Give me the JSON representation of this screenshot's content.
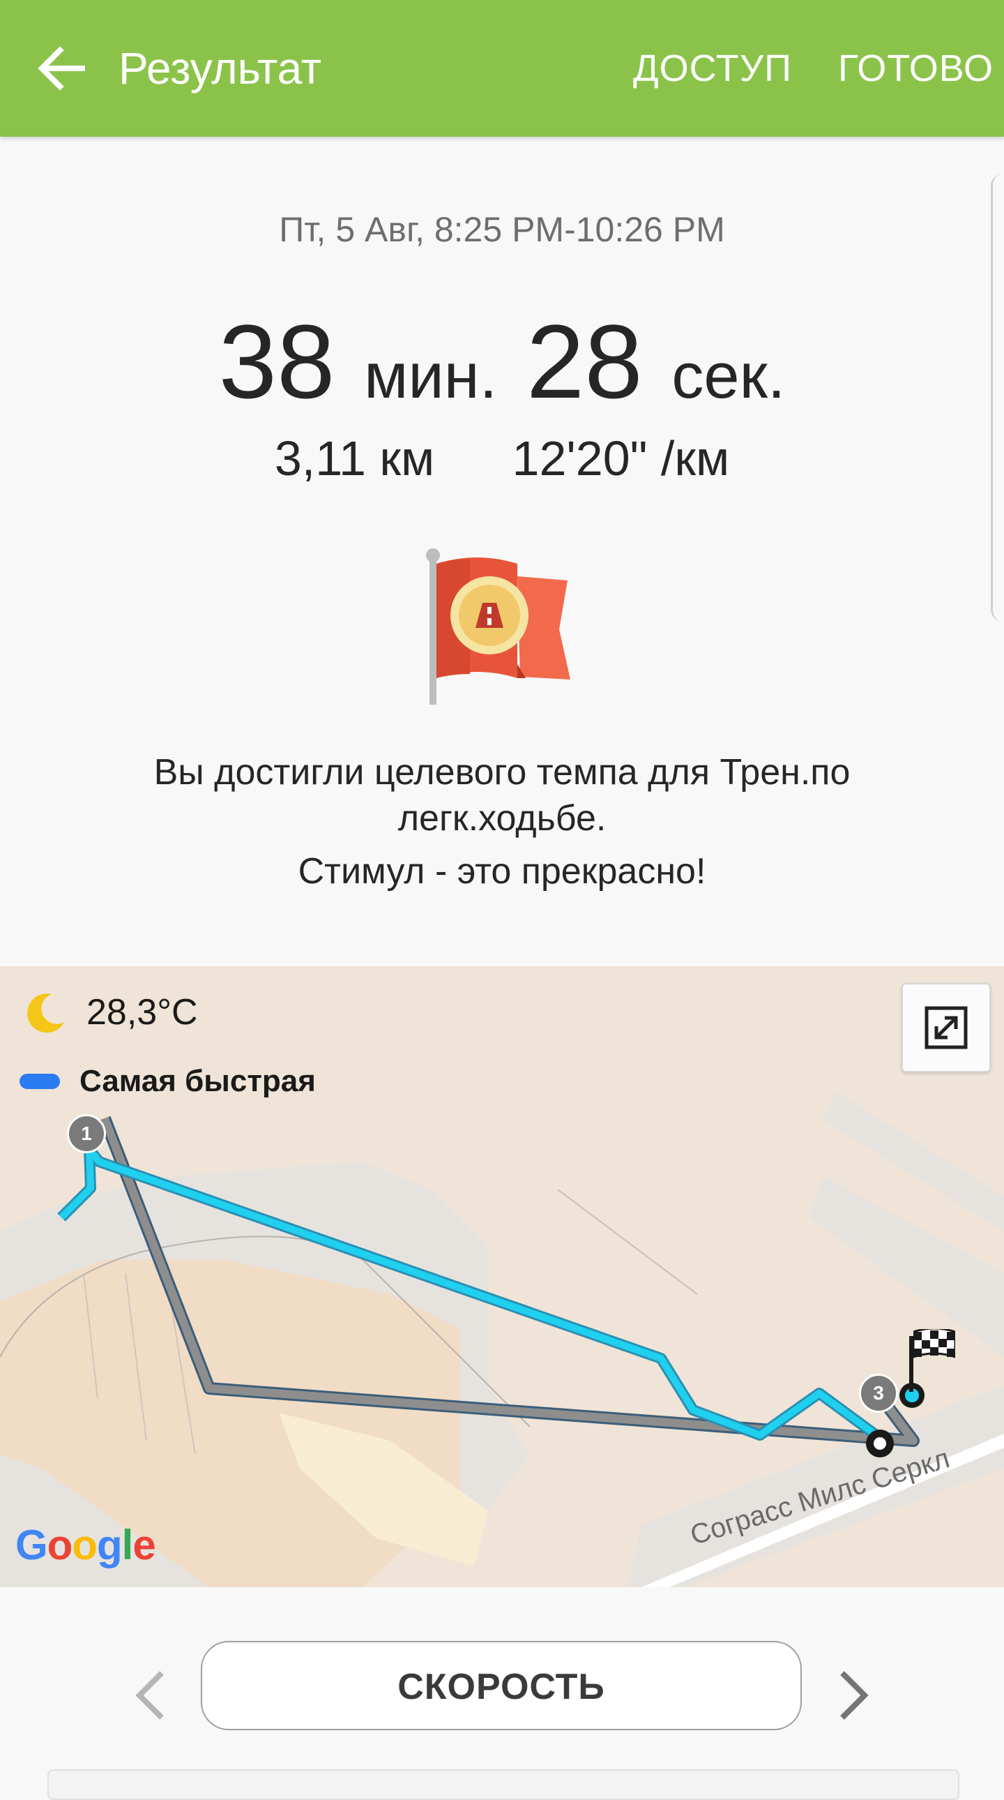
{
  "header": {
    "title": "Результат",
    "share_label": "ДОСТУП",
    "done_label": "ГОТОВО",
    "background_color": "#8bc34a"
  },
  "summary": {
    "datetime": "Пт, 5 Авг, 8:25 PM-10:26 PM",
    "minutes": "38",
    "minutes_unit": "мин.",
    "seconds": "28",
    "seconds_unit": "сек.",
    "distance": "3,11 км",
    "pace": "12'20\" /км",
    "achievement_icon": "target-pace-flag-icon",
    "message_line1": "Вы достигли целевого темпа для Трен.по легк.ходьбе.",
    "message_line2": "Стимул - это прекрасно!"
  },
  "map": {
    "weather_icon": "moon-icon",
    "temperature": "28,3°C",
    "legend_label": "Самая быстрая",
    "legend_color": "#2b7bf2",
    "route_color": "#1fd0ef",
    "lap_marker_1": "1",
    "lap_marker_3": "3",
    "street_label": "Сограсс Милс Серкл",
    "provider_logo": "Google"
  },
  "bottom": {
    "metric_label": "СКОРОСТЬ"
  }
}
